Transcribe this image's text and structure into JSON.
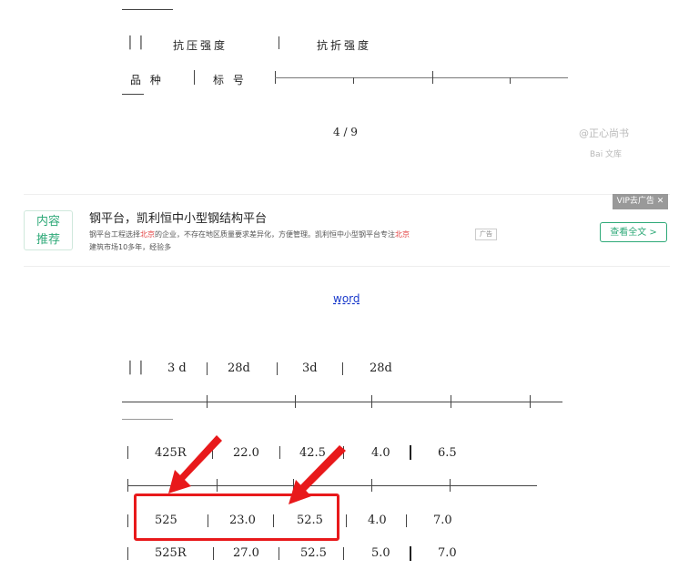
{
  "top_table": {
    "header_bars": "│ │",
    "compressive": "抗压强度",
    "flexural": "抗折强度",
    "variety": "品 种",
    "grade": "标 号"
  },
  "page_indicator": "4 / 9",
  "watermark": {
    "author": "@正心尚书",
    "brand": "Bai 文库"
  },
  "ad": {
    "logo_line1": "内容",
    "logo_line2": "推荐",
    "title": "钢平台，凯利恒中小型钢结构平台",
    "desc_part1": "钢平台工程选择",
    "desc_hl1": "北京",
    "desc_part2": "的企业，不存在地区质量要求差异化，方便管理。凯利恒中小型钢平台专注",
    "desc_hl2": "北京",
    "desc_part3": "建筑市场10多年，经验多",
    "tag": "广告",
    "button": "查看全文 >",
    "vip_close": "VIP去广告 ✕"
  },
  "word_link": "word",
  "table2": {
    "header_lead": "│ │",
    "headers": [
      "3 d",
      "28d",
      "3d",
      "28d"
    ],
    "rows": [
      {
        "variety": "425R",
        "c3": "22.0",
        "c28": "42.5",
        "f3": "4.0",
        "f28": "6.5"
      },
      {
        "variety": "525",
        "c3": "23.0",
        "c28": "52.5",
        "f3": "4.0",
        "f28": "7.0"
      },
      {
        "variety": "525R",
        "c3": "27.0",
        "c28": "52.5",
        "f3": "5.0",
        "f28": "7.0"
      }
    ]
  },
  "colors": {
    "accent_green": "#2ea978",
    "highlight_red": "#e8191b",
    "link_blue": "#1a3acb"
  }
}
